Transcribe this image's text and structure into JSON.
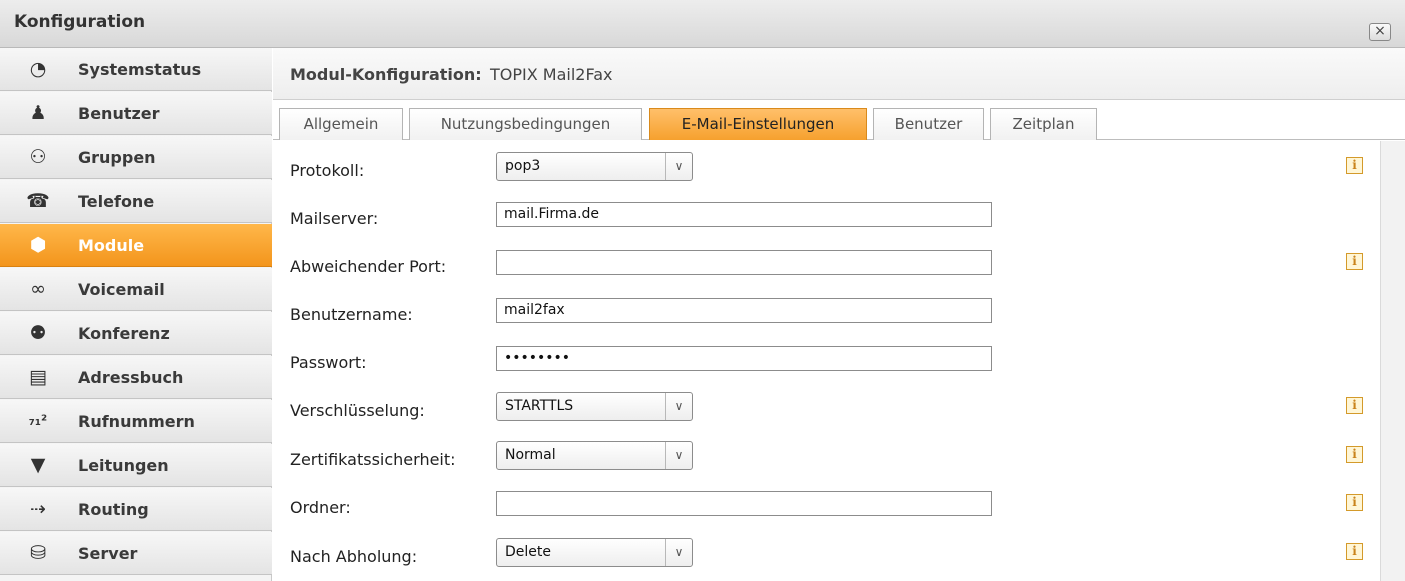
{
  "window": {
    "title": "Konfiguration",
    "close_label": "×"
  },
  "sidebar": {
    "items": [
      {
        "label": "Systemstatus",
        "icon": "◔",
        "name": "systemstatus",
        "icon_name": "pie-chart-icon"
      },
      {
        "label": "Benutzer",
        "icon": "♟",
        "name": "benutzer",
        "icon_name": "user-icon"
      },
      {
        "label": "Gruppen",
        "icon": "⚇",
        "name": "gruppen",
        "icon_name": "group-icon"
      },
      {
        "label": "Telefone",
        "icon": "☎",
        "name": "telefone",
        "icon_name": "phone-icon"
      },
      {
        "label": "Module",
        "icon": "⬢",
        "name": "module",
        "icon_name": "cube-icon",
        "active": true
      },
      {
        "label": "Voicemail",
        "icon": "∞",
        "name": "voicemail",
        "icon_name": "voicemail-icon"
      },
      {
        "label": "Konferenz",
        "icon": "⚉",
        "name": "konferenz",
        "icon_name": "conference-icon"
      },
      {
        "label": "Adressbuch",
        "icon": "▤",
        "name": "adressbuch",
        "icon_name": "addressbook-icon"
      },
      {
        "label": "Rufnummern",
        "icon": "₇₁²",
        "name": "rufnummern",
        "icon_name": "numbers-icon"
      },
      {
        "label": "Leitungen",
        "icon": "▼",
        "name": "leitungen",
        "icon_name": "plug-icon"
      },
      {
        "label": "Routing",
        "icon": "⇢",
        "name": "routing",
        "icon_name": "routing-icon"
      },
      {
        "label": "Server",
        "icon": "⛁",
        "name": "server",
        "icon_name": "server-icon"
      }
    ]
  },
  "header": {
    "label": "Modul-Konfiguration:",
    "value": "TOPIX Mail2Fax"
  },
  "tabs": [
    {
      "label": "Allgemein"
    },
    {
      "label": "Nutzungsbedingungen"
    },
    {
      "label": "E-Mail-Einstellungen",
      "active": true
    },
    {
      "label": "Benutzer"
    },
    {
      "label": "Zeitplan"
    }
  ],
  "form": {
    "protokoll": {
      "label": "Protokoll:",
      "value": "pop3"
    },
    "mailserver": {
      "label": "Mailserver:",
      "value": "mail.Firma.de"
    },
    "port": {
      "label": "Abweichender Port:",
      "value": ""
    },
    "benutzername": {
      "label": "Benutzername:",
      "value": "mail2fax"
    },
    "passwort": {
      "label": "Passwort:",
      "value": "••••••••"
    },
    "verschluesselung": {
      "label": "Verschlüsselung:",
      "value": "STARTTLS"
    },
    "zertifikat": {
      "label": "Zertifikatssicherheit:",
      "value": "Normal"
    },
    "ordner": {
      "label": "Ordner:",
      "value": ""
    },
    "abholung": {
      "label": "Nach Abholung:",
      "value": "Delete"
    }
  },
  "info_glyph": "i",
  "select_arrow": "∨"
}
